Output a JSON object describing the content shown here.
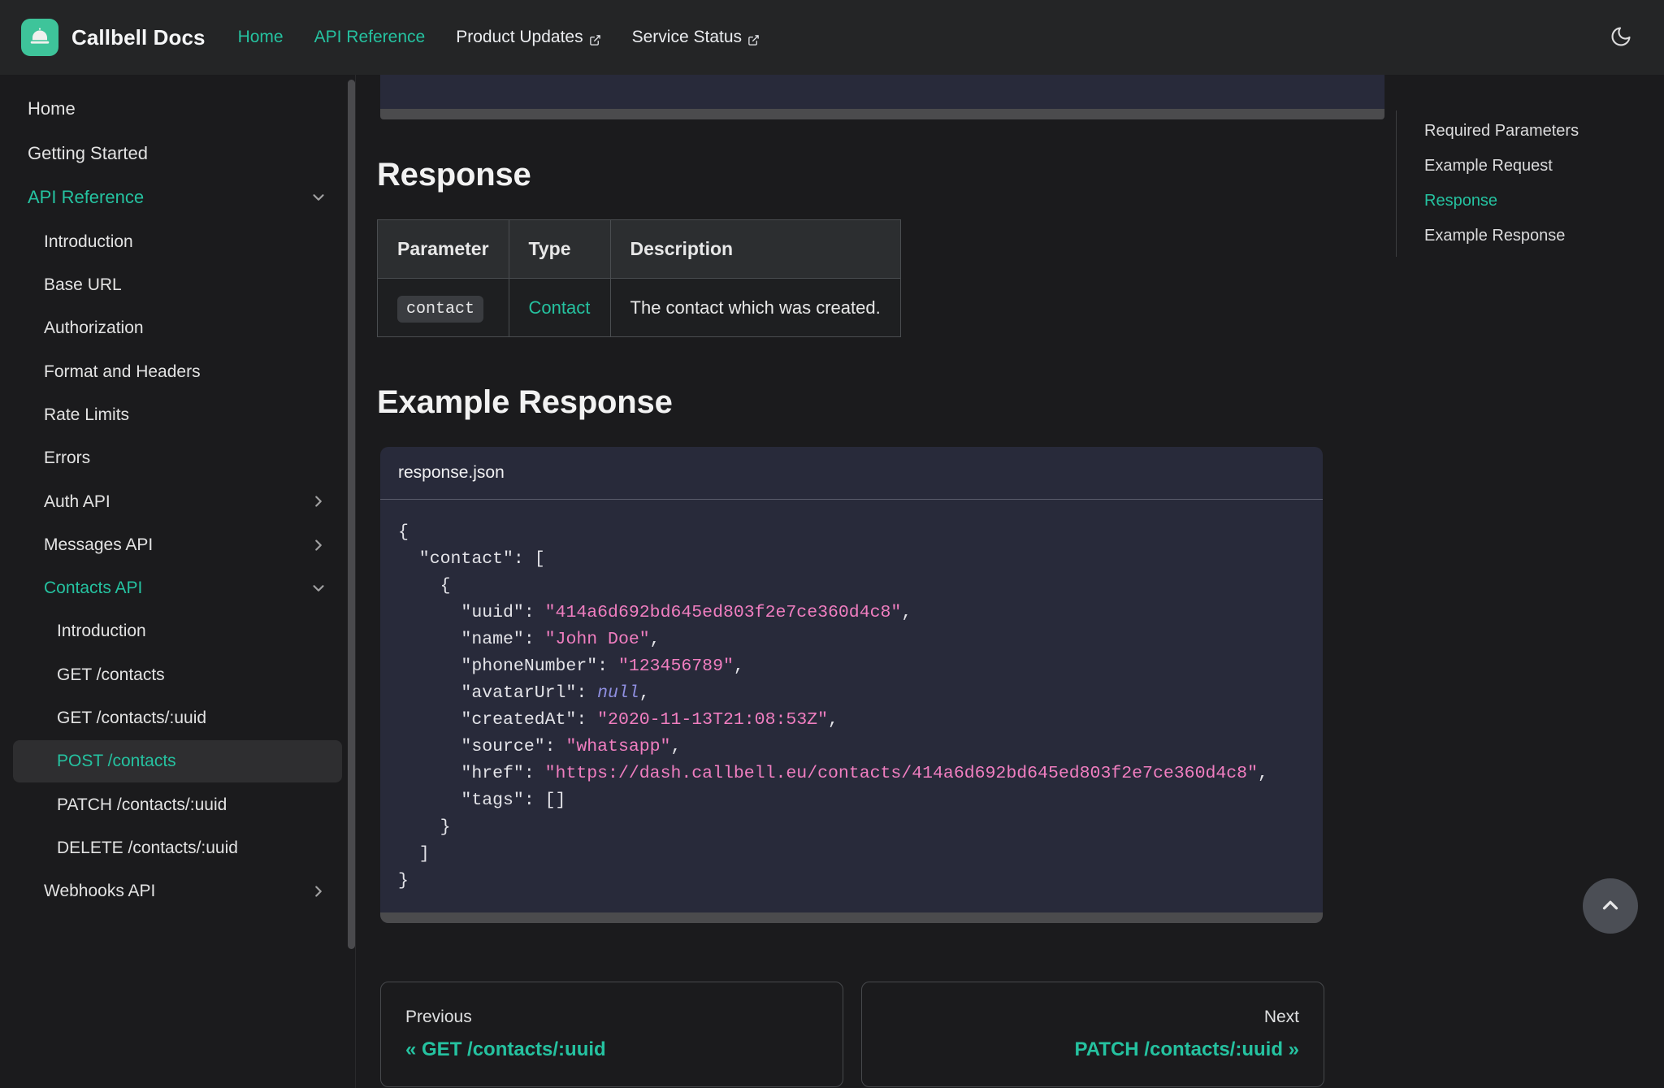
{
  "navbar": {
    "brand": "Callbell Docs",
    "logo_icon": "service-bell-icon",
    "links": [
      {
        "label": "Home",
        "active": true,
        "external": false
      },
      {
        "label": "API Reference",
        "active": true,
        "external": false
      },
      {
        "label": "Product Updates",
        "active": false,
        "external": true
      },
      {
        "label": "Service Status",
        "active": false,
        "external": true
      }
    ],
    "theme_toggle_icon": "moon-icon"
  },
  "sidebar": {
    "items": [
      {
        "label": "Home",
        "level": 1,
        "state": "plain"
      },
      {
        "label": "Getting Started",
        "level": 1,
        "state": "plain"
      },
      {
        "label": "API Reference",
        "level": 1,
        "state": "green",
        "caret": "down"
      },
      {
        "label": "Introduction",
        "level": 2,
        "state": "plain"
      },
      {
        "label": "Base URL",
        "level": 2,
        "state": "plain"
      },
      {
        "label": "Authorization",
        "level": 2,
        "state": "plain"
      },
      {
        "label": "Format and Headers",
        "level": 2,
        "state": "plain"
      },
      {
        "label": "Rate Limits",
        "level": 2,
        "state": "plain"
      },
      {
        "label": "Errors",
        "level": 2,
        "state": "plain"
      },
      {
        "label": "Auth API",
        "level": 2,
        "state": "plain",
        "caret": "right"
      },
      {
        "label": "Messages API",
        "level": 2,
        "state": "plain",
        "caret": "right"
      },
      {
        "label": "Contacts API",
        "level": 2,
        "state": "green",
        "caret": "down"
      },
      {
        "label": "Introduction",
        "level": 3,
        "state": "plain"
      },
      {
        "label": "GET /contacts",
        "level": 3,
        "state": "plain"
      },
      {
        "label": "GET /contacts/:uuid",
        "level": 3,
        "state": "plain"
      },
      {
        "label": "POST /contacts",
        "level": 3,
        "state": "active"
      },
      {
        "label": "PATCH /contacts/:uuid",
        "level": 3,
        "state": "plain"
      },
      {
        "label": "DELETE /contacts/:uuid",
        "level": 3,
        "state": "plain"
      },
      {
        "label": "Webhooks API",
        "level": 2,
        "state": "plain",
        "caret": "right"
      }
    ]
  },
  "content": {
    "response_heading": "Response",
    "table": {
      "headers": [
        "Parameter",
        "Type",
        "Description"
      ],
      "rows": [
        {
          "parameter": "contact",
          "type": "Contact",
          "description": "The contact which was created."
        }
      ]
    },
    "example_heading": "Example Response",
    "code": {
      "filename": "response.json",
      "language": "json",
      "lines": [
        "{",
        "  \"contact\": [",
        "    {",
        "      \"uuid\": \"414a6d692bd645ed803f2e7ce360d4c8\",",
        "      \"name\": \"John Doe\",",
        "      \"phoneNumber\": \"123456789\",",
        "      \"avatarUrl\": null,",
        "      \"createdAt\": \"2020-11-13T21:08:53Z\",",
        "      \"source\": \"whatsapp\",",
        "      \"href\": \"https://dash.callbell.eu/contacts/414a6d692bd645ed803f2e7ce360d4c8\",",
        "      \"tags\": []",
        "    }",
        "  ]",
        "}"
      ]
    }
  },
  "pager": {
    "previous_label": "Previous",
    "previous_title": "« GET /contacts/:uuid",
    "next_label": "Next",
    "next_title": "PATCH /contacts/:uuid »"
  },
  "toc": {
    "items": [
      {
        "label": "Required Parameters",
        "active": false
      },
      {
        "label": "Example Request",
        "active": false
      },
      {
        "label": "Response",
        "active": true
      },
      {
        "label": "Example Response",
        "active": false
      }
    ]
  },
  "scroll_top": {
    "icon": "chevron-up-icon"
  },
  "colors": {
    "accent": "#25c2a0",
    "logo": "#3ec49a",
    "page_bg": "#1b1b1d",
    "navbar_bg": "#242526",
    "code_bg": "#282a3a",
    "string": "#f07ec0",
    "null": "#8f8fe0"
  }
}
